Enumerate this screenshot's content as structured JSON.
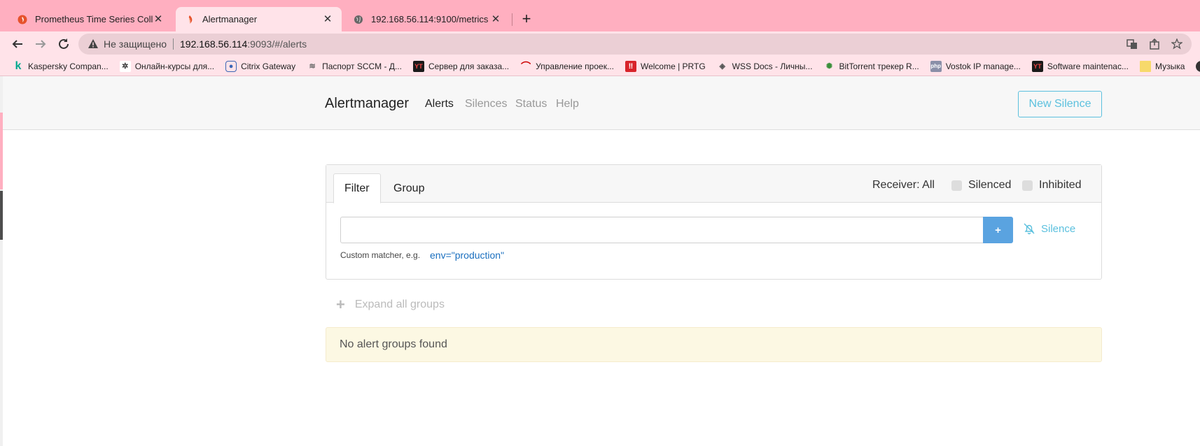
{
  "browser": {
    "tabs": [
      {
        "title": "Prometheus Time Series Collectio",
        "active": false,
        "icon": "prometheus-flame-icon"
      },
      {
        "title": "Alertmanager",
        "active": true,
        "icon": "prometheus-flame-icon"
      },
      {
        "title": "192.168.56.114:9100/metrics",
        "active": false,
        "icon": "globe-icon"
      }
    ],
    "new_tab": "+",
    "omnibox": {
      "insecure_label": "Не защищено",
      "host": "192.168.56.114",
      "path": ":9093/#/alerts"
    },
    "bookmarks": [
      {
        "label": "Kaspersky Compan...",
        "icon": "kaspersky-icon"
      },
      {
        "label": "Онлайн-курсы для...",
        "icon": "course-icon"
      },
      {
        "label": "Citrix Gateway",
        "icon": "citrix-icon"
      },
      {
        "label": "Паспорт SCCM - Д...",
        "icon": "sccm-icon"
      },
      {
        "label": "Сервер для заказа...",
        "icon": "yt-icon"
      },
      {
        "label": "Управление проек...",
        "icon": "project-icon"
      },
      {
        "label": "Welcome | PRTG",
        "icon": "prtg-icon"
      },
      {
        "label": "WSS Docs - Личны...",
        "icon": "wss-icon"
      },
      {
        "label": "BitTorrent трекер R...",
        "icon": "bittorrent-icon"
      },
      {
        "label": "Vostok IP manage...",
        "icon": "php-icon"
      },
      {
        "label": "Software maintenac...",
        "icon": "yt-icon"
      },
      {
        "label": "Музыка",
        "icon": "folder-icon"
      }
    ]
  },
  "app": {
    "brand": "Alertmanager",
    "nav": [
      "Alerts",
      "Silences",
      "Status",
      "Help"
    ],
    "new_silence": "New Silence"
  },
  "filter": {
    "tabs": [
      "Filter",
      "Group"
    ],
    "receiver": "Receiver: All",
    "silenced": "Silenced",
    "inhibited": "Inhibited",
    "input_value": "",
    "add_button": "+",
    "silence_link": "Silence",
    "hint": "Custom matcher, e.g.",
    "example": "env=\"production\""
  },
  "expand_all": "Expand all groups",
  "empty_message": "No alert groups found",
  "colors": {
    "tabstrip": "#ffafc0",
    "toolbar": "#ffe3e9",
    "accent_info": "#5bc0de",
    "button_primary": "#5aa3e0",
    "warning_bg": "#fcf8e3"
  }
}
